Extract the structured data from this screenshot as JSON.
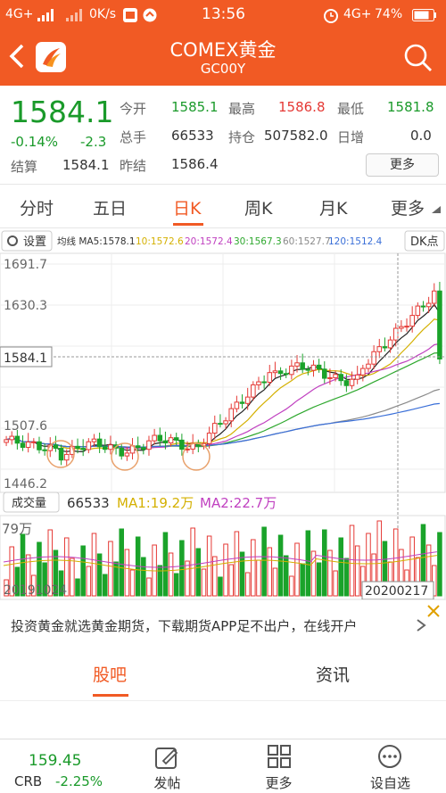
{
  "status_bar": {
    "carrier1": "4G+",
    "speed": "0K/s",
    "time": "13:56",
    "network2": "4G+",
    "battery": "74%"
  },
  "header": {
    "title": "COMEX黄金",
    "subtitle": "GC00Y"
  },
  "quote": {
    "price": "1584.1",
    "change_pct": "-0.14%",
    "change": "-2.3",
    "settle_label": "结算",
    "settle_value": "1584.1",
    "open_label": "今开",
    "open_value": "1585.1",
    "high_label": "最高",
    "high_value": "1586.8",
    "low_label": "最低",
    "low_value": "1581.8",
    "volume_label": "总手",
    "volume_value": "66533",
    "oi_label": "持仓",
    "oi_value": "507582.0",
    "oi_change_label": "日增",
    "oi_change_value": "0.0",
    "prev_settle_label": "昨结",
    "prev_settle_value": "1586.4",
    "more_button": "更多"
  },
  "tabs": [
    {
      "label": "分时"
    },
    {
      "label": "五日"
    },
    {
      "label": "日K"
    },
    {
      "label": "周K"
    },
    {
      "label": "月K"
    },
    {
      "label": "更多"
    }
  ],
  "active_tab": "日K",
  "chart": {
    "settings_label": "设置",
    "ma_header": "均线 MA5:1578.1",
    "ma10": "10:1572.6",
    "ma20": "20:1572.4",
    "ma30": "30:1567.3",
    "ma60": "60:1527.7",
    "ma120": "120:1512.4",
    "dk_button": "DK点",
    "y_ticks": [
      "1691.7",
      "1630.3",
      "1507.6",
      "1446.2"
    ],
    "current_price_tag": "1584.1",
    "volume_button": "成交量",
    "volume_value": "66533",
    "vol_ma1": "MA1:19.2万",
    "vol_ma2": "MA2:22.7万",
    "vol_max": "79万",
    "date_start": "20191024",
    "date_end": "20200217",
    "colors": {
      "up": "#e53935",
      "down": "#1aa32a",
      "ma5": "#222222",
      "ma10": "#d4b000",
      "ma20": "#c040c0",
      "ma30": "#2ea82e",
      "ma60": "#8a8a8a",
      "ma120": "#3a6fd8"
    }
  },
  "chart_data": {
    "type": "candlestick",
    "y_range": [
      1446.2,
      1691.7
    ],
    "x_range": [
      "20191024",
      "20200217"
    ],
    "latest": {
      "close": 1584.1,
      "open": 1585.1,
      "high": 1586.8,
      "low": 1581.8,
      "volume": 66533
    },
    "moving_averages": {
      "MA5": 1578.1,
      "MA10": 1572.6,
      "MA20": 1572.4,
      "MA30": 1567.3,
      "MA60": 1527.7,
      "MA120": 1512.4
    },
    "volume_ma": {
      "MA1": "19.2万",
      "MA2": "22.7万"
    },
    "volume_max": "79万"
  },
  "ad": {
    "text": "投资黄金就选黄金期货，下载期货APP足不出户，在线开户"
  },
  "section_tabs": [
    {
      "label": "股吧"
    },
    {
      "label": "资讯"
    }
  ],
  "bottom_nav": {
    "crb_label": "CRB",
    "crb_value": "159.45",
    "crb_change": "-2.25%",
    "items": [
      {
        "label": "发帖",
        "icon": "edit-icon"
      },
      {
        "label": "更多",
        "icon": "grid-icon"
      },
      {
        "label": "设自选",
        "icon": "more-dots-icon"
      }
    ]
  }
}
